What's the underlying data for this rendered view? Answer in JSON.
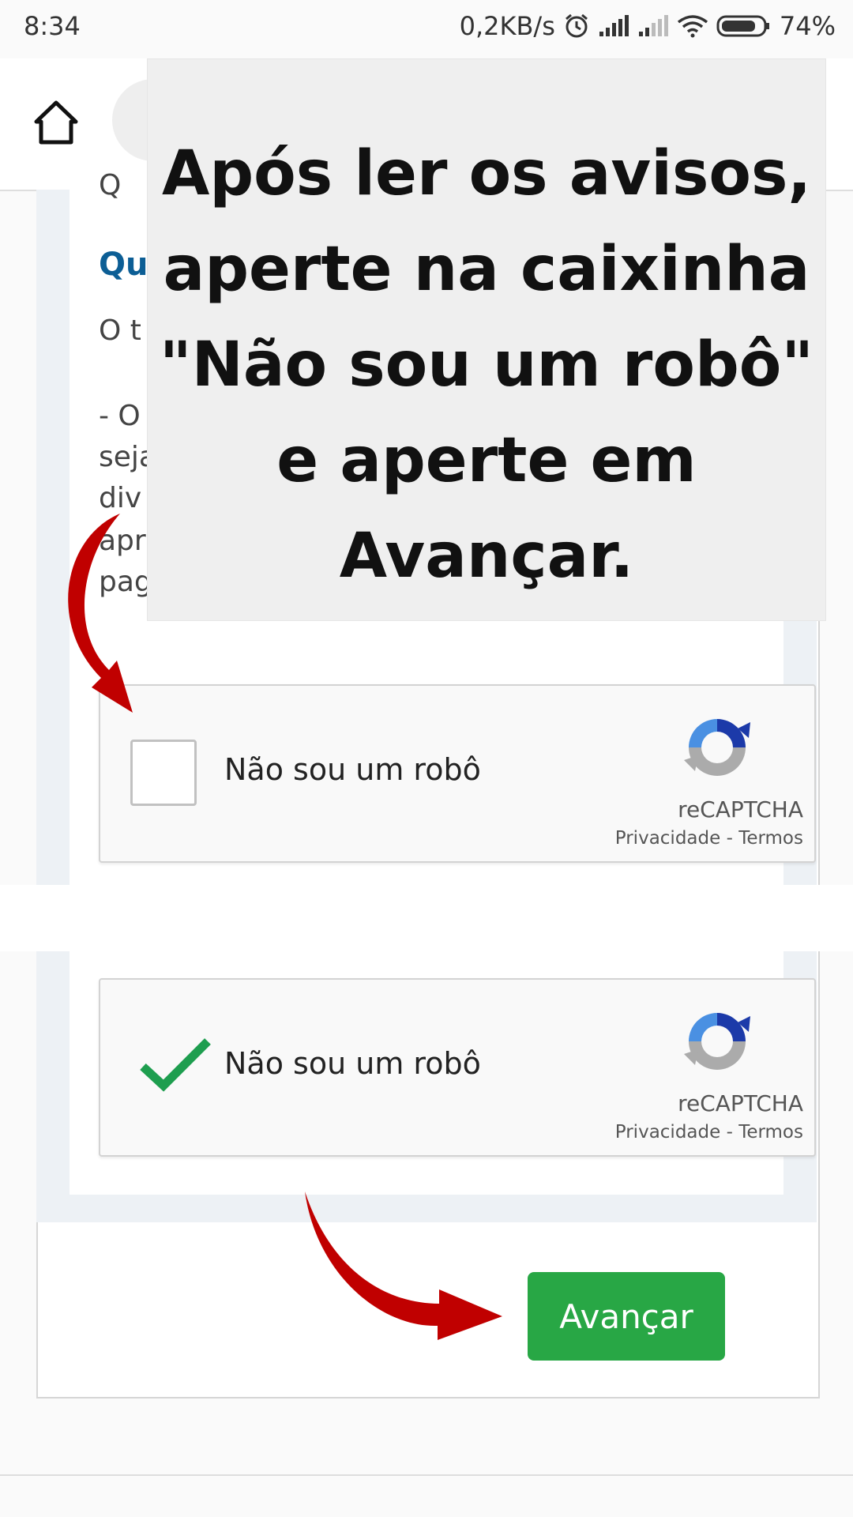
{
  "status_bar": {
    "time": "8:34",
    "speed": "0,2KB/s",
    "battery": "74%",
    "icons": [
      "alarm-icon",
      "signal-icon",
      "signal-weak-icon",
      "wifi-icon",
      "battery-icon"
    ]
  },
  "app_bar": {
    "home_icon": "home-icon"
  },
  "page": {
    "partial_text_1": "Q",
    "heading_partial": "Qu",
    "partial_text_2": "O t",
    "list_partial": [
      "- O",
      "seja",
      "div",
      "apr",
      "pag"
    ]
  },
  "overlay": {
    "text": "Após ler os avisos, aperte na caixinha \"Não sou um robô\" e aperte em Avançar."
  },
  "recaptcha_unchecked": {
    "label": "Não sou um robô",
    "brand": "reCAPTCHA",
    "privacy": "Privacidade",
    "separator": " - ",
    "terms": "Termos",
    "checked": false
  },
  "recaptcha_checked": {
    "label": "Não sou um robô",
    "brand": "reCAPTCHA",
    "privacy": "Privacidade",
    "separator": " - ",
    "terms": "Termos",
    "checked": true
  },
  "button": {
    "label": "Avançar",
    "color": "#28a745"
  },
  "colors": {
    "arrow_red": "#c00000",
    "check_green": "#1e9e4f",
    "heading_blue": "#0c5e95"
  }
}
